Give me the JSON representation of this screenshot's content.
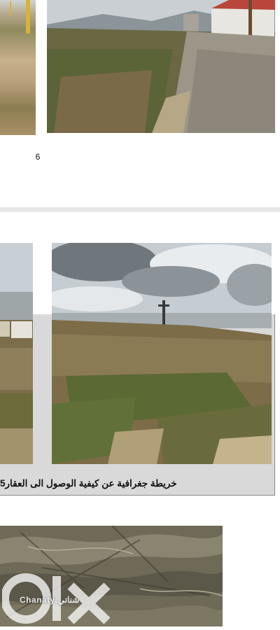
{
  "page1": {
    "page_number": "6"
  },
  "page2": {
    "caption": "خريطة جغرافية عن كيفية الوصول الى العقار5"
  },
  "watermark": {
    "brand_lettering": "olx",
    "agency_text": "Chanaty شناتي"
  },
  "colors": {
    "sky": "#cfd7dd",
    "ground": "#8a7a55",
    "grass": "#5c6a33",
    "panel_gray": "#d9d9d9"
  }
}
